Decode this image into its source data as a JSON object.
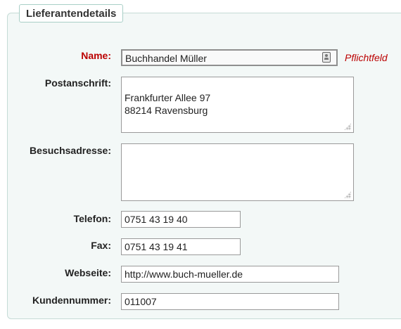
{
  "fieldset": {
    "legend": "Lieferantendetails"
  },
  "fields": {
    "name": {
      "label": "Name:",
      "value": "Buchhandel Müller",
      "required_note": "Pflichtfeld"
    },
    "postanschrift": {
      "label": "Postanschrift:",
      "value": "Frankfurter Allee 97\n88214 Ravensburg"
    },
    "besuchsadresse": {
      "label": "Besuchsadresse:",
      "value": ""
    },
    "telefon": {
      "label": "Telefon:",
      "value": "0751 43 19 40"
    },
    "fax": {
      "label": "Fax:",
      "value": "0751 43 19 41"
    },
    "webseite": {
      "label": "Webseite:",
      "value": "http://www.buch-mueller.de"
    },
    "kundennummer": {
      "label": "Kundennummer:",
      "value": "011007"
    }
  },
  "icons": {
    "name_field_icon": "contact-card-icon",
    "resize_handle": "resize-grip-icon"
  },
  "colors": {
    "required": "#bb0000",
    "panel_bg": "#f3f8f7",
    "panel_border": "#c5dbd6"
  }
}
